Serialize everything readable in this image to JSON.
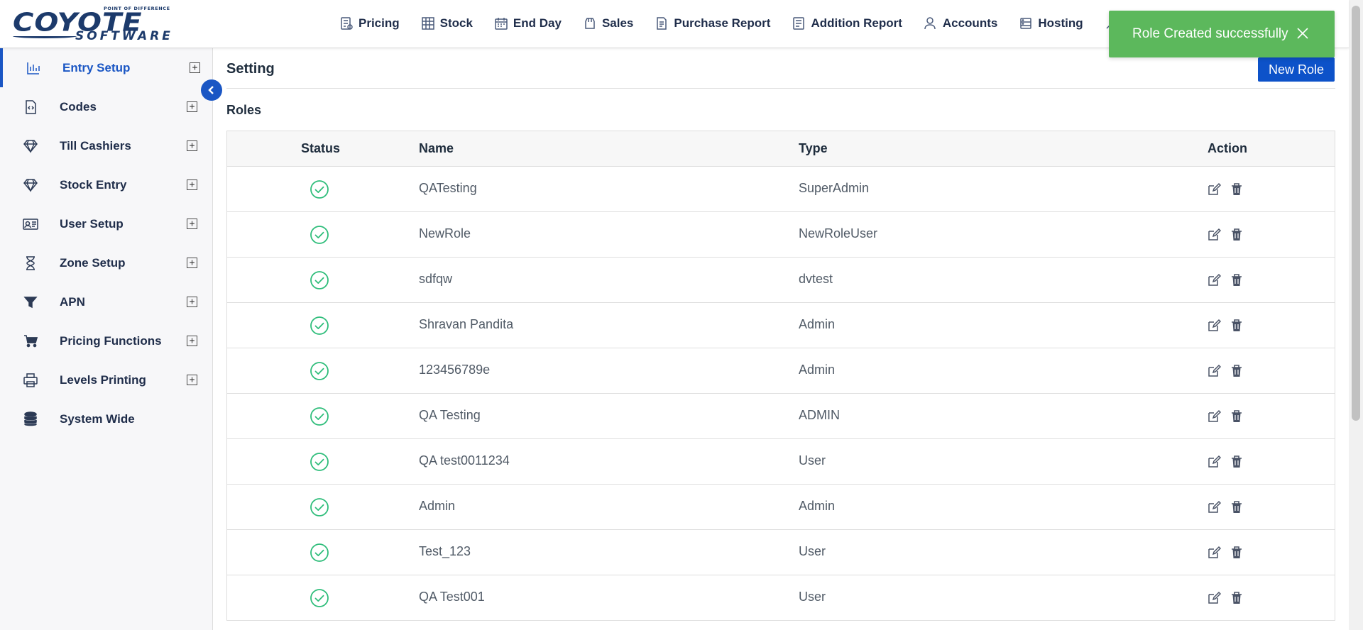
{
  "brand": {
    "name": "COYOTE",
    "tagline": "POINT OF DIFFERENCE",
    "sub": "SOFTWARE"
  },
  "nav": [
    {
      "label": "Pricing",
      "icon": "pricing-icon"
    },
    {
      "label": "Stock",
      "icon": "stock-icon"
    },
    {
      "label": "End Day",
      "icon": "calendar-icon"
    },
    {
      "label": "Sales",
      "icon": "sales-icon"
    },
    {
      "label": "Purchase Report",
      "icon": "report-icon"
    },
    {
      "label": "Addition Report",
      "icon": "report-icon"
    },
    {
      "label": "Accounts",
      "icon": "user-icon"
    },
    {
      "label": "Hosting",
      "icon": "hosting-icon"
    }
  ],
  "toast": {
    "message": "Role Created successfully"
  },
  "sidebar": {
    "items": [
      {
        "label": "Entry Setup",
        "icon": "bar-chart-icon",
        "active": true,
        "expandable": true
      },
      {
        "label": "Codes",
        "icon": "code-file-icon",
        "expandable": true
      },
      {
        "label": "Till Cashiers",
        "icon": "diamond-icon",
        "expandable": true
      },
      {
        "label": "Stock Entry",
        "icon": "diamond-icon",
        "expandable": true
      },
      {
        "label": "User Setup",
        "icon": "id-card-icon",
        "expandable": true
      },
      {
        "label": "Zone Setup",
        "icon": "hourglass-icon",
        "expandable": true
      },
      {
        "label": "APN",
        "icon": "filter-icon",
        "expandable": true
      },
      {
        "label": "Pricing Functions",
        "icon": "cart-icon",
        "expandable": true
      },
      {
        "label": "Levels Printing",
        "icon": "printer-icon",
        "expandable": true
      },
      {
        "label": "System Wide",
        "icon": "database-icon",
        "expandable": false
      }
    ]
  },
  "main": {
    "title": "Setting",
    "new_role_label": "New Role",
    "section_title": "Roles",
    "columns": {
      "status": "Status",
      "name": "Name",
      "type": "Type",
      "action": "Action"
    },
    "rows": [
      {
        "name": "QATesting",
        "type": "SuperAdmin"
      },
      {
        "name": "NewRole",
        "type": "NewRoleUser"
      },
      {
        "name": "sdfqw",
        "type": "dvtest"
      },
      {
        "name": "Shravan Pandita",
        "type": "Admin"
      },
      {
        "name": "123456789e",
        "type": "Admin"
      },
      {
        "name": "QA Testing",
        "type": "ADMIN"
      },
      {
        "name": "QA test0011234",
        "type": "User"
      },
      {
        "name": "Admin",
        "type": "Admin"
      },
      {
        "name": "Test_123",
        "type": "User"
      },
      {
        "name": "QA Test001",
        "type": "User"
      }
    ]
  },
  "colors": {
    "accent": "#1a56c4",
    "button": "#0d52c9",
    "toast": "#5cb85c",
    "status_ok": "#2ebd7a"
  }
}
